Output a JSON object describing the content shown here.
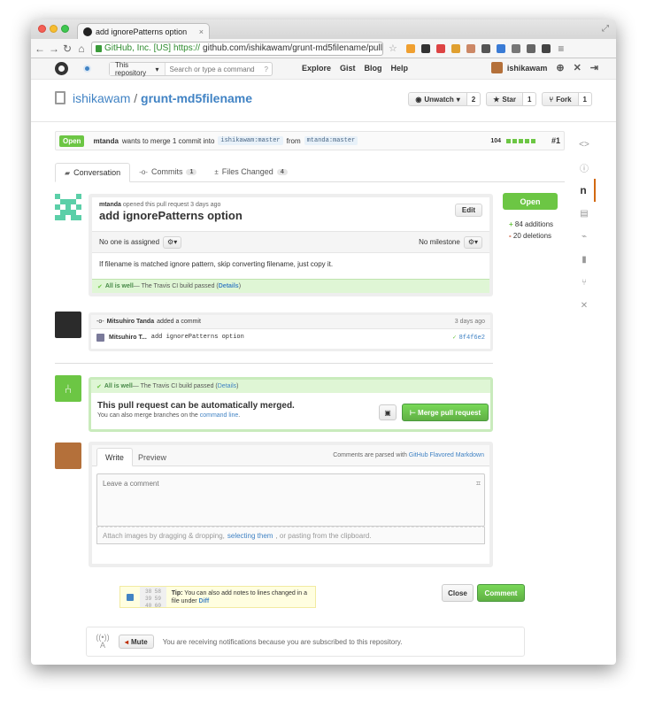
{
  "browser": {
    "tab_title": "add ignorePatterns option",
    "tab_close": "×",
    "ev_label": "GitHub, Inc. [US]",
    "url_scheme": "https://",
    "url_rest": "github.com/ishikawam/grunt-md5filename/pull/1"
  },
  "header": {
    "scope_label": "This repository",
    "search_placeholder": "Search or type a command",
    "help": "?",
    "links": [
      "Explore",
      "Gist",
      "Blog",
      "Help"
    ],
    "username": "ishikawam"
  },
  "repo": {
    "owner": "ishikawam",
    "separator": "/",
    "name": "grunt-md5filename",
    "unwatch_label": "Unwatch",
    "unwatch_count": "2",
    "star_label": "Star",
    "star_count": "1",
    "fork_label": "Fork",
    "fork_count": "1"
  },
  "pr": {
    "state": "Open",
    "author": "mtanda",
    "merge_text": "wants to merge 1 commit into",
    "base_branch": "ishikawam:master",
    "from_text": "from",
    "head_branch": "mtanda:master",
    "diff_total": "104",
    "number": "#1",
    "tabs": [
      {
        "label": "Conversation",
        "count": ""
      },
      {
        "label": "Commits",
        "count": "1"
      },
      {
        "label": "Files Changed",
        "count": "4"
      }
    ],
    "opened_by": "mtanda",
    "opened_text": "opened this pull request 3 days ago",
    "title": "add ignorePatterns option",
    "edit_label": "Edit",
    "assignee": "No one is assigned",
    "milestone": "No milestone",
    "body": "If filename is matched ignore pattern, skip converting filename, just copy it.",
    "ci_ok": "All is well",
    "ci_text": " — The Travis CI build passed (",
    "ci_link": "Details",
    "ci_close": ")",
    "status_badge": "Open",
    "additions": "84 additions",
    "deletions": "20 deletions"
  },
  "commit_event": {
    "actor": "Mitsuhiro Tanda",
    "action": "added a commit",
    "time": "3 days ago",
    "author_short": "Mitsuhiro T...",
    "message": "add ignorePatterns option",
    "sha": "8f4f6e2"
  },
  "merge": {
    "ci_ok": "All is well",
    "ci_text": " — The Travis CI build passed (",
    "ci_link": "Details",
    "ci_close": ")",
    "title": "This pull request can be automatically merged.",
    "sub_text": "You can also merge branches on the ",
    "sub_link": "command line",
    "sub_end": ".",
    "button": "Merge pull request"
  },
  "comment": {
    "write_tab": "Write",
    "preview_tab": "Preview",
    "md_text": "Comments are parsed with ",
    "md_link": "GitHub Flavored Markdown",
    "placeholder": "Leave a comment",
    "attach_before": "Attach images by dragging & dropping,",
    "attach_link": "selecting them",
    "attach_after": ", or pasting from the clipboard.",
    "tip_label": "Tip:",
    "tip_text": "You can also add notes to lines changed in a file under",
    "tip_link": "Diff",
    "tip_lines": [
      "38  58",
      "39  59",
      "40  60"
    ],
    "close_label": "Close",
    "comment_label": "Comment"
  },
  "notifications": {
    "mute_label": "Mute",
    "text": "You are receiving notifications because you are subscribed to this repository."
  },
  "colors": {
    "green": "#6cc644",
    "link": "#4183c4",
    "deletion": "#bd2c00"
  }
}
